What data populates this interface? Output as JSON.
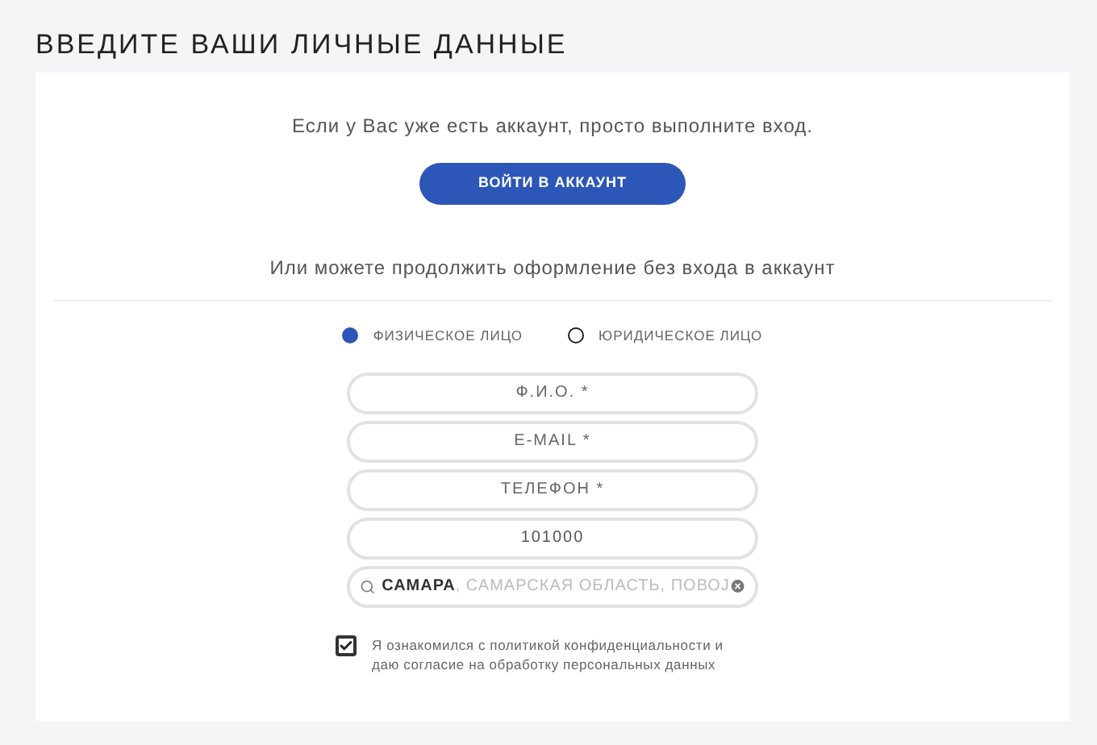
{
  "heading": "ВВЕДИТЕ ВАШИ ЛИЧНЫЕ ДАННЫЕ",
  "login_prompt": "Если у Вас уже есть аккаунт, просто выполните вход.",
  "login_button": "ВОЙТИ В АККАУНТ",
  "guest_prompt": "Или можете продолжить оформление без входа в аккаунт",
  "customer_types": [
    {
      "label": "ФИЗИЧЕСКОЕ ЛИЦО",
      "selected": true
    },
    {
      "label": "ЮРИДИЧЕСКОЕ ЛИЦО",
      "selected": false
    }
  ],
  "fields": [
    {
      "placeholder": "Ф.И.О. *"
    },
    {
      "placeholder": "E-MAIL *"
    },
    {
      "placeholder": "ТЕЛЕФОН *"
    },
    {
      "value": "101000"
    }
  ],
  "city_field": {
    "value": "САМАРА",
    "suggestion": ", САМАРСКАЯ ОБЛАСТЬ, ПОВОЈ"
  },
  "consent": {
    "checked": true,
    "text": "Я ознакомился с политикой конфиденциальности и даю согласие на обработку персональных данных"
  }
}
